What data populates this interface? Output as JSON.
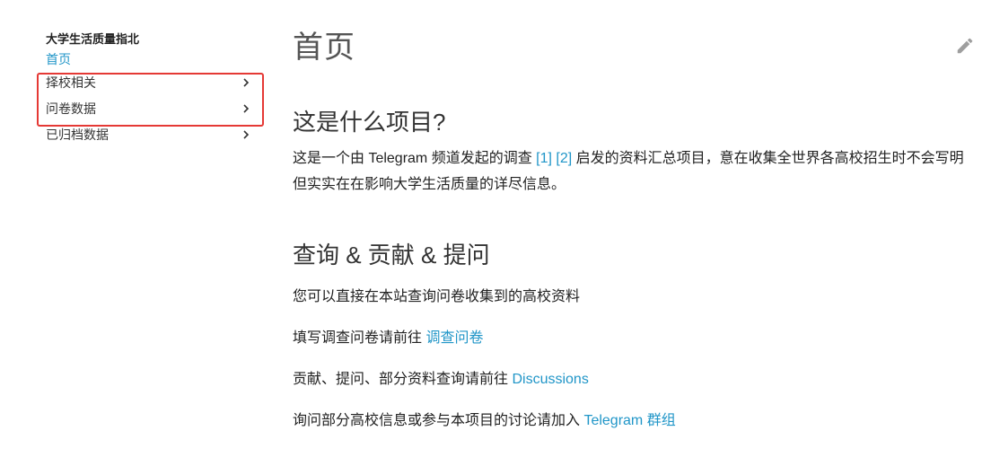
{
  "sidebar": {
    "site_title": "大学生活质量指北",
    "items": [
      {
        "label": "首页",
        "active": true
      },
      {
        "label": "择校相关",
        "has_children": true
      },
      {
        "label": "问卷数据",
        "has_children": true
      },
      {
        "label": "已归档数据",
        "has_children": true
      }
    ]
  },
  "main": {
    "title": "首页",
    "section1": {
      "heading": "这是什么项目?",
      "p_before": "这是一个由 Telegram 频道发起的调查 ",
      "link1": "[1]",
      "link2": "[2]",
      "p_after": " 启发的资料汇总项目，意在收集全世界各高校招生时不会写明但实实在在影响大学生活质量的详尽信息。"
    },
    "section2": {
      "heading": "查询 & 贡献 & 提问",
      "line1": "您可以直接在本站查询问卷收集到的高校资料",
      "line2_text": "填写调查问卷请前往 ",
      "line2_link": "调查问卷",
      "line3_text": "贡献、提问、部分资料查询请前往 ",
      "line3_link": "Discussions",
      "line4_text": "询问部分高校信息或参与本项目的讨论请加入 ",
      "line4_link": "Telegram 群组"
    }
  },
  "colors": {
    "link": "#2196c8",
    "highlight": "#e53935"
  },
  "icons": {
    "edit": "pencil-icon",
    "chevron": "chevron-right-icon"
  }
}
